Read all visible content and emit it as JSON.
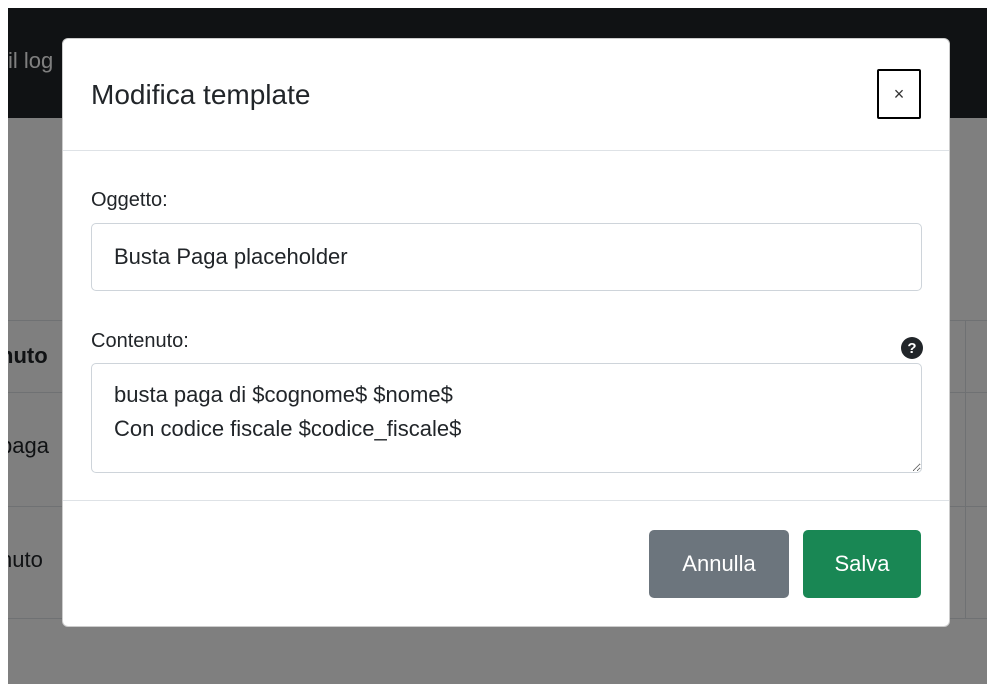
{
  "background": {
    "topbar_text": "il log",
    "table_header_fragment": "nuto",
    "row1_fragment": "paga",
    "row2_fragment": "nuto"
  },
  "modal": {
    "title": "Modifica template",
    "close_label": "×",
    "subject": {
      "label": "Oggetto:",
      "value": "Busta Paga placeholder"
    },
    "content": {
      "label": "Contenuto:",
      "value": "busta paga di $cognome$ $nome$\nCon codice fiscale $codice_fiscale$",
      "help_icon_glyph": "?"
    },
    "buttons": {
      "cancel_label": "Annulla",
      "save_label": "Salva"
    }
  },
  "colors": {
    "topbar": "#212529",
    "cancel": "#6c757d",
    "save": "#198754"
  },
  "icons": {
    "close": "close-icon",
    "help": "question-circle-icon"
  }
}
